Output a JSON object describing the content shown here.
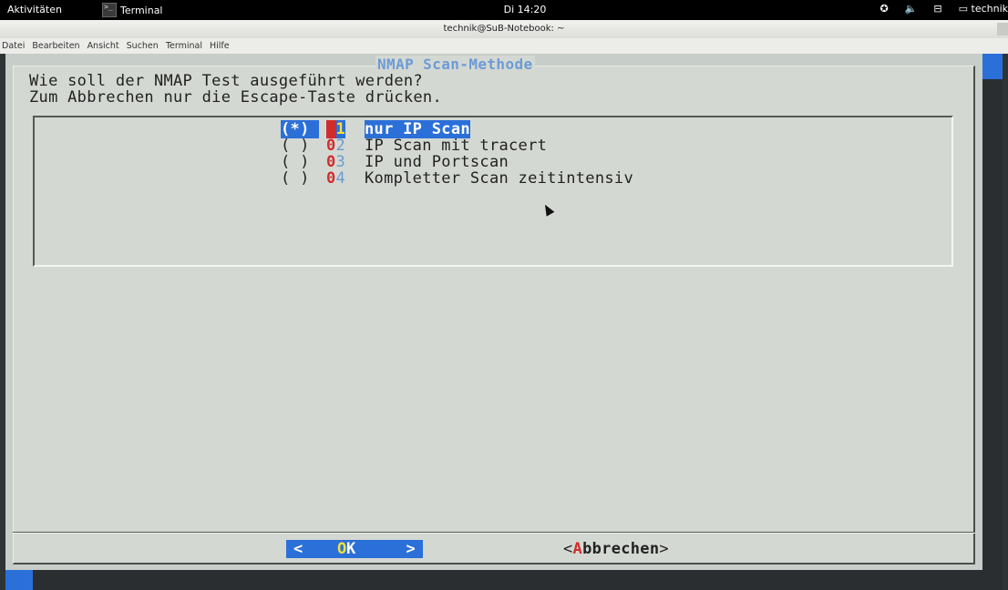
{
  "topbar": {
    "activities": "Aktivitäten",
    "app_name": "Terminal",
    "app_icon_glyph": ">_",
    "clock": "Di 14:20",
    "user": "technik",
    "tray_icons": [
      "accessibility-icon",
      "volume-icon",
      "network-icon",
      "user-icon"
    ]
  },
  "window": {
    "title": "technik@SuB-Notebook: ~"
  },
  "menubar": {
    "items": [
      "Datei",
      "Bearbeiten",
      "Ansicht",
      "Suchen",
      "Terminal",
      "Hilfe"
    ]
  },
  "dialog": {
    "title": "NMAP Scan-Methode",
    "prompt_line1": "Wie soll der NMAP Test ausgeführt werden?",
    "prompt_line2": "Zum Abbrechen nur die Escape-Taste drücken.",
    "options": [
      {
        "radio": "(*)",
        "tag_first": "0",
        "tag_second": "1",
        "label": "nur IP Scan",
        "selected": true
      },
      {
        "radio": "( )",
        "tag_first": "0",
        "tag_second": "2",
        "label": "IP Scan mit tracert",
        "selected": false
      },
      {
        "radio": "( )",
        "tag_first": "0",
        "tag_second": "3",
        "label": "IP und Portscan",
        "selected": false
      },
      {
        "radio": "( )",
        "tag_first": "0",
        "tag_second": "4",
        "label": "Kompletter Scan zeitintensiv",
        "selected": false
      }
    ],
    "ok_button": {
      "left": "<",
      "hot": "O",
      "rest": "K",
      "right": ">"
    },
    "cancel_button": {
      "open": "<",
      "hot": "A",
      "rest": "bbrechen",
      "close": ">"
    }
  },
  "colors": {
    "terminal_bg": "#c7cdc8",
    "dialog_bg": "#d4d8d2",
    "selection": "#2b6fd8",
    "hotkey_red": "#d12c2c",
    "hotkey_yellow": "#f3e03a",
    "title_blue": "#6b9bd6"
  }
}
